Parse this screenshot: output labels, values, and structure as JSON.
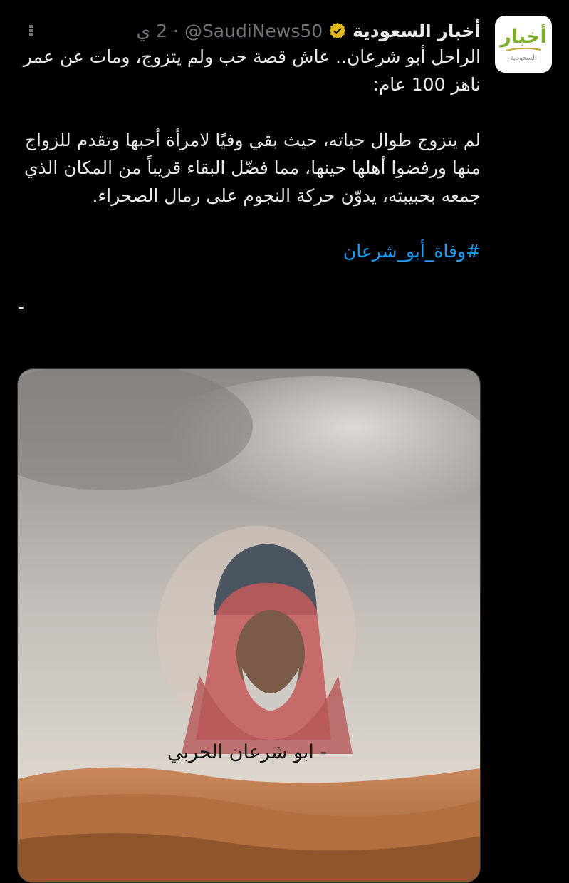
{
  "tweet": {
    "author_name": "أخبار السعودية",
    "handle": "@SaudiNews50",
    "separator": "·",
    "time": "2 ي",
    "paragraph1": "الراحل أبو شرعان.. عاش قصة حب ولم يتزوج، ومات عن عمر ناهز 100 عام:",
    "paragraph2": "لم يتزوج طوال حياته، حيث بقي وفيًا لامرأة أحبها وتقدم للزواج منها ورفضوا أهلها حينها، مما فضّل البقاء قريباً من المكان الذي جمعه بحبيبته، يدوّن حركة النجوم على رمال الصحراء.",
    "hashtag": "#وفاة_أبو_شرعان",
    "trailing": "-"
  },
  "avatar": {
    "logo_text": "أخبار",
    "logo_subtext": "السعودية"
  },
  "media": {
    "caption": "- ابو شرعان الحربي"
  },
  "icons": {
    "verified": "verified-badge-icon",
    "more": "more-options-icon"
  },
  "colors": {
    "background": "#000000",
    "text": "#e7e9ea",
    "muted": "#71767b",
    "link": "#1d9bf0",
    "verified_gold": "#e2b719",
    "logo_green": "#7fae2a"
  }
}
